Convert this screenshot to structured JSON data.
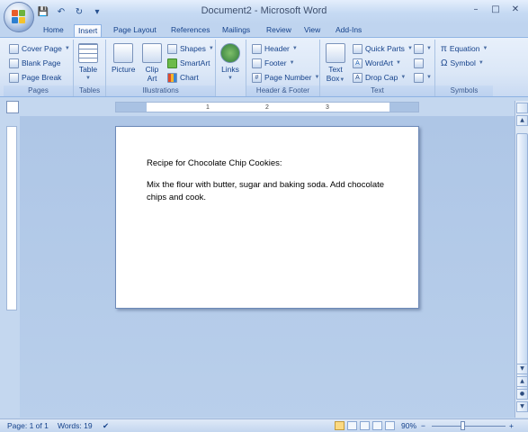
{
  "window": {
    "title": "Document2 - Microsoft Word",
    "minimize": "–",
    "maximize": "□",
    "close": "✕"
  },
  "qat": {
    "save": "💾",
    "undo": "↶",
    "redo": "↻",
    "customize": "▾"
  },
  "tabs": [
    {
      "label": "Home"
    },
    {
      "label": "Insert"
    },
    {
      "label": "Page Layout"
    },
    {
      "label": "References"
    },
    {
      "label": "Mailings"
    },
    {
      "label": "Review"
    },
    {
      "label": "View"
    },
    {
      "label": "Add-Ins"
    }
  ],
  "ribbon": {
    "pages": {
      "label": "Pages",
      "cover_page": "Cover Page",
      "blank_page": "Blank Page",
      "page_break": "Page Break"
    },
    "tables": {
      "label": "Tables",
      "table": "Table"
    },
    "illustrations": {
      "label": "Illustrations",
      "picture": "Picture",
      "clip_art_1": "Clip",
      "clip_art_2": "Art",
      "shapes": "Shapes",
      "smartart": "SmartArt",
      "chart": "Chart"
    },
    "links": {
      "label": "Links"
    },
    "header_footer": {
      "label": "Header & Footer",
      "header": "Header",
      "footer": "Footer",
      "page_number": "Page Number"
    },
    "text": {
      "label": "Text",
      "text_box_1": "Text",
      "text_box_2": "Box",
      "quick_parts": "Quick Parts",
      "wordart": "WordArt",
      "drop_cap": "Drop Cap"
    },
    "symbols": {
      "label": "Symbols",
      "equation": "Equation",
      "symbol": "Symbol"
    }
  },
  "ruler": {
    "t1": "1",
    "t2": "2",
    "t3": "3"
  },
  "document": {
    "line1": "Recipe for Chocolate Chip Cookies:",
    "paragraph": "Mix the flour with butter, sugar and baking soda. Add chocolate chips and cook."
  },
  "status": {
    "page": "Page: 1 of 1",
    "words": "Words: 19",
    "zoom": "90%",
    "zoom_minus": "−",
    "zoom_plus": "+"
  },
  "colors": {
    "accent": "#15428b",
    "ribbon": "#dbe7f7",
    "canvas": "#b9cfeb"
  }
}
